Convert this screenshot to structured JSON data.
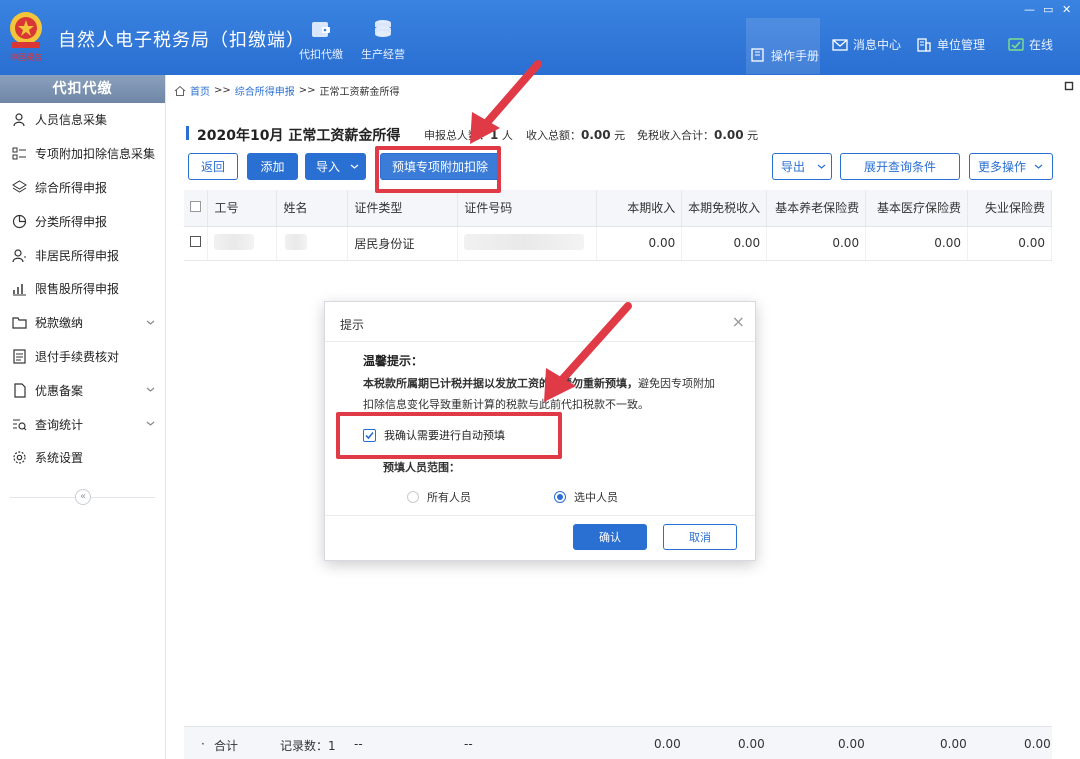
{
  "app": {
    "title": "自然人电子税务局（扣缴端）",
    "logo_text": "中国税务",
    "nav": [
      {
        "label": "代扣代缴",
        "icon": "wallet-icon"
      },
      {
        "label": "生产经营",
        "icon": "coins-icon"
      }
    ],
    "toolbar": {
      "manual": "操作手册",
      "messages": "消息中心",
      "unit": "单位管理",
      "status": "在线"
    },
    "window_controls": [
      "—",
      "▭",
      "✕"
    ]
  },
  "sidebar": {
    "header": "代扣代缴",
    "items": [
      {
        "label": "人员信息采集",
        "icon": "person-icon",
        "expandable": false
      },
      {
        "label": "专项附加扣除信息采集",
        "icon": "grid-list-icon",
        "expandable": false
      },
      {
        "label": "综合所得申报",
        "icon": "layers-icon",
        "expandable": false
      },
      {
        "label": "分类所得申报",
        "icon": "pie-icon",
        "expandable": false
      },
      {
        "label": "非居民所得申报",
        "icon": "person-outline-icon",
        "expandable": false
      },
      {
        "label": "限售股所得申报",
        "icon": "bar-chart-icon",
        "expandable": false
      },
      {
        "label": "税款缴纳",
        "icon": "folder-icon",
        "expandable": true
      },
      {
        "label": "退付手续费核对",
        "icon": "doc-list-icon",
        "expandable": false
      },
      {
        "label": "优惠备案",
        "icon": "file-icon",
        "expandable": true
      },
      {
        "label": "查询统计",
        "icon": "search-list-icon",
        "expandable": true
      },
      {
        "label": "系统设置",
        "icon": "gear-icon",
        "expandable": false
      }
    ],
    "collapse": "«"
  },
  "breadcrumb": {
    "home": "首页",
    "sep": ">>",
    "level2": "综合所得申报",
    "level3": "正常工资薪金所得"
  },
  "page": {
    "title": "2020年10月 正常工资薪金所得",
    "summary": {
      "people_label": "申报总人数：",
      "people_value": "1",
      "people_unit": "人",
      "income_label": "收入总额：",
      "income_value": "0.00",
      "income_unit": "元",
      "exempt_label": "免税收入合计：",
      "exempt_value": "0.00",
      "exempt_unit": "元"
    }
  },
  "buttons": {
    "back": "返回",
    "add": "添加",
    "import": "导入",
    "prefill": "预填专项附加扣除",
    "export": "导出",
    "expand": "展开查询条件",
    "more": "更多操作"
  },
  "table": {
    "columns": [
      "工号",
      "姓名",
      "证件类型",
      "证件号码",
      "本期收入",
      "本期免税收入",
      "基本养老保险费",
      "基本医疗保险费",
      "失业保险费"
    ],
    "rows": [
      {
        "id_type": "居民身份证",
        "income": "0.00",
        "exempt": "0.00",
        "pension": "0.00",
        "medical": "0.00",
        "unemployment": "0.00"
      }
    ],
    "footer": {
      "dot": "·",
      "total": "合计",
      "records": "记录数：1",
      "dash1": "--",
      "dash2": "--",
      "values": [
        "0.00",
        "0.00",
        "0.00",
        "0.00",
        "0.00"
      ]
    }
  },
  "modal": {
    "title": "提示",
    "close": "×",
    "warm_title": "温馨提示：",
    "body_strong": "本税款所属期已计税并据以发放工资的，请勿重新预填，",
    "body_rest": "避免因专项附加扣除信息变化导致重新计算的税款与此前代扣税款不一致。",
    "checkbox_label": "我确认需要进行自动预填",
    "checkbox_checked": true,
    "range_label": "预填人员范围：",
    "options": [
      {
        "label": "所有人员",
        "selected": false
      },
      {
        "label": "选中人员",
        "selected": true
      }
    ],
    "confirm": "确认",
    "cancel": "取消"
  },
  "colors": {
    "brand_blue": "#2a6fd2",
    "annotation_red": "#e03a47"
  }
}
